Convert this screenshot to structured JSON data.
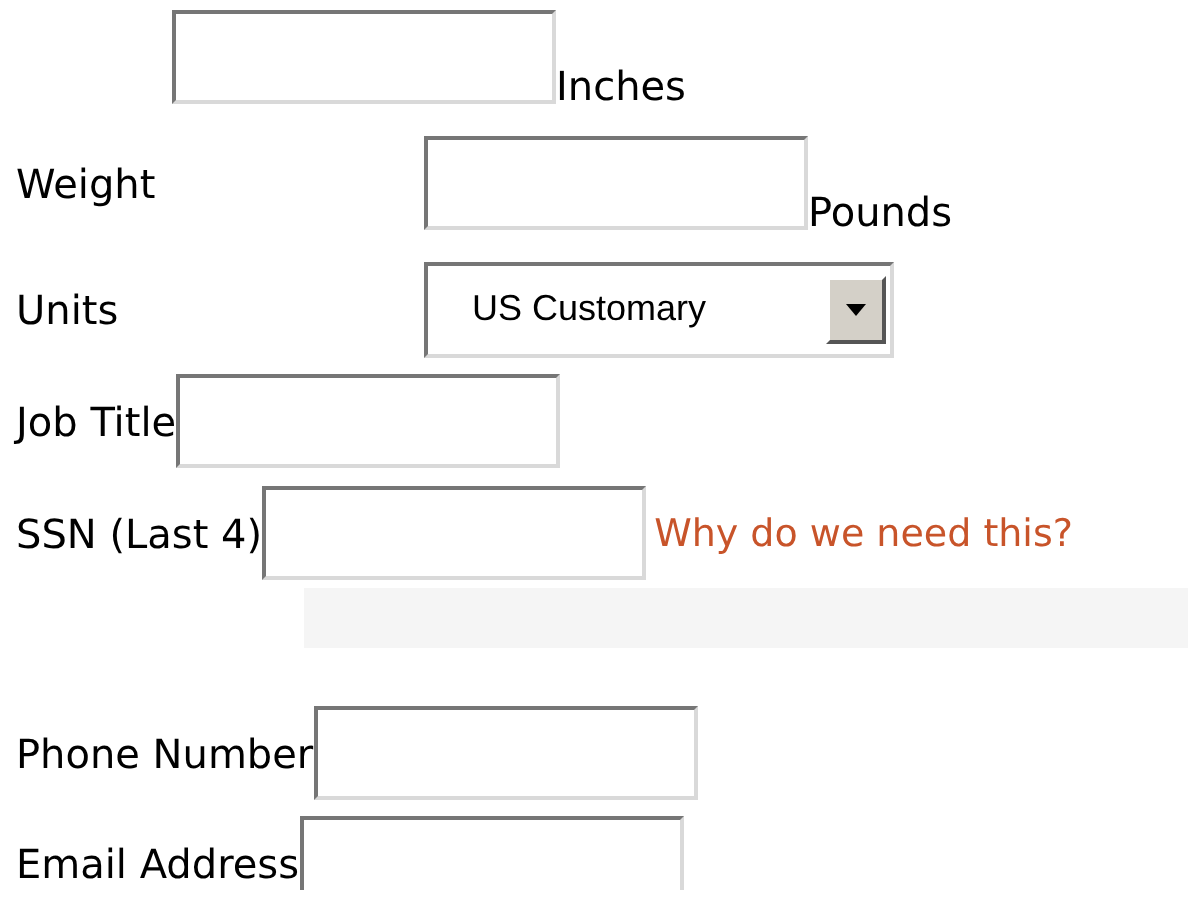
{
  "rows": [
    {
      "kind": "measure",
      "unit": "Inches"
    },
    {
      "kind": "measure",
      "label": "Weight",
      "unit": "Pounds"
    },
    {
      "kind": "select",
      "label": "Units",
      "value": "US Customary"
    },
    {
      "kind": "input",
      "label": "Job Title"
    },
    {
      "kind": "help",
      "label": "SSN (Last 4)",
      "link": "Why do we need this?"
    },
    {
      "kind": "bar"
    },
    {
      "kind": "input",
      "label": "Phone Number"
    },
    {
      "kind": "input",
      "label": "Email Address"
    }
  ]
}
